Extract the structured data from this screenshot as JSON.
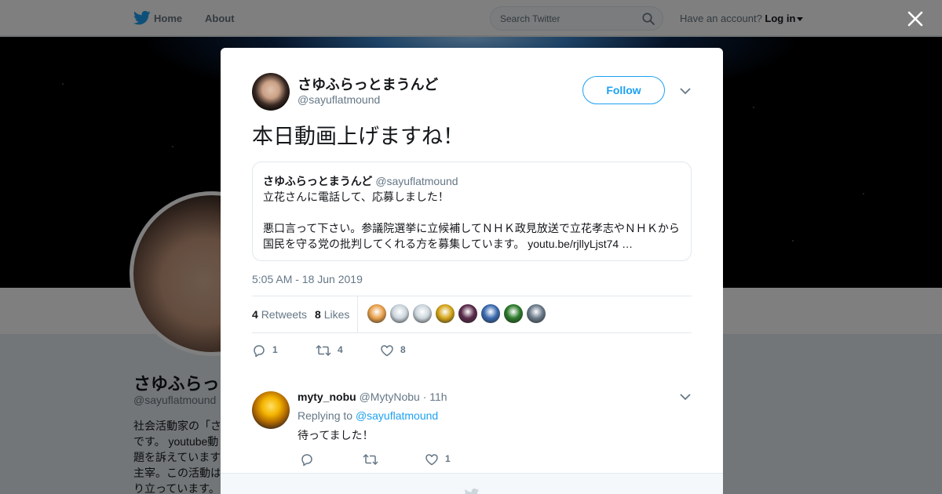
{
  "colors": {
    "twitter_blue": "#1da1f2",
    "text_primary": "#14171a",
    "text_secondary": "#657786",
    "border": "#e1e8ed"
  },
  "nav": {
    "home_label": "Home",
    "about_label": "About",
    "search_placeholder": "Search Twitter",
    "account_prompt": "Have an account?",
    "login_label": "Log in"
  },
  "background_profile": {
    "name": "さゆふらっとまうんど",
    "handle": "@sayuflatmound",
    "bio": "社会活動家の「さ\nです。 youtube動\n題を訴えています\n主宰。この活動は\nり立っています。"
  },
  "tweet": {
    "author_name": "さゆふらっとまうんど",
    "author_handle": "@sayuflatmound",
    "follow_label": "Follow",
    "text": "本日動画上げますね！",
    "quoted": {
      "author_name": "さゆふらっとまうんど",
      "author_handle": "@sayuflatmound",
      "text": "立花さんに電話して、応募しました！\n\n悪口言って下さい。参議院選挙に立候補してＮＨＫ政見放送で立花孝志やＮＨＫから国民を守る党の批判してくれる方を募集しています。 youtu.be/rjllyLjst74 …"
    },
    "timestamp": "5:05 AM - 18 Jun 2019",
    "retweets_count": "4",
    "retweets_label": "Retweets",
    "likes_count": "8",
    "likes_label": "Likes",
    "likers": [
      {
        "icon": "liker-avatar-1",
        "color": "#e8a04a"
      },
      {
        "icon": "liker-avatar-2",
        "color": "#ccd6dd"
      },
      {
        "icon": "liker-avatar-3",
        "color": "#ccd6dd"
      },
      {
        "icon": "liker-avatar-4",
        "color": "#d4a418"
      },
      {
        "icon": "liker-avatar-5",
        "color": "#5a2a4a"
      },
      {
        "icon": "liker-avatar-6",
        "color": "#3a6ab0"
      },
      {
        "icon": "liker-avatar-7",
        "color": "#2a7a2a"
      },
      {
        "icon": "liker-avatar-8",
        "color": "#6a7a8a"
      }
    ],
    "actions": {
      "replies": "1",
      "retweets": "4",
      "likes": "8"
    }
  },
  "reply": {
    "author_name": "myty_nobu",
    "author_handle": "@MytyNobu",
    "separator": "·",
    "time": "11h",
    "replying_prefix": "Replying to",
    "replying_to": "@sayuflatmound",
    "text": "待ってました！",
    "actions": {
      "likes": "1"
    }
  }
}
